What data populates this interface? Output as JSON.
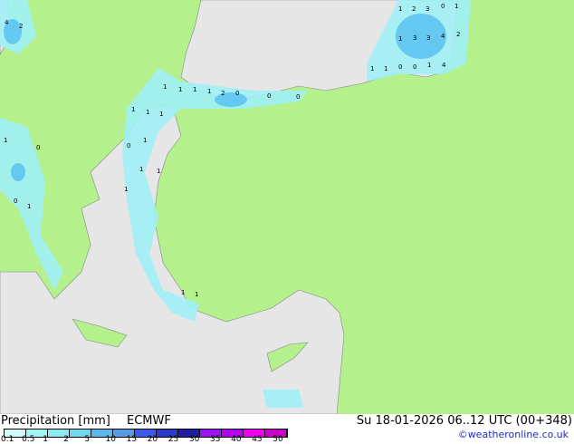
{
  "title": "Precipitation [mm]",
  "model": "ECMWF",
  "valid": "Su 18-01-2026 06..12 UTC (00+348)",
  "credit": "©weatheronline.co.uk",
  "legend": {
    "labels": [
      "0.1",
      "0.5",
      "1",
      "2",
      "5",
      "10",
      "15",
      "20",
      "25",
      "30",
      "35",
      "40",
      "45",
      "50"
    ],
    "colors": [
      "#d2fafa",
      "#a0f5f5",
      "#8ceaf0",
      "#6ed8ee",
      "#5ab9e8",
      "#5a9be6",
      "#3c5af0",
      "#2d3cc8",
      "#1e1ea0",
      "#9b14f0",
      "#b400f0",
      "#f000f0",
      "#c800c8"
    ]
  },
  "colors": {
    "land": "#b4f08c",
    "sea": "#e6e6e6",
    "precip_light": "#a0f0f5",
    "precip_mid": "#64c8f0"
  },
  "map_labels": [
    "1",
    "2",
    "3",
    "0",
    "1",
    "1",
    "3",
    "3",
    "4",
    "2",
    "1",
    "1",
    "0",
    "0",
    "1",
    "4",
    "1",
    "1",
    "1",
    "1",
    "2",
    "0",
    "0",
    "0",
    "1",
    "1",
    "1",
    "1",
    "0",
    "1",
    "1",
    "1",
    "0",
    "1",
    "4",
    "2",
    "0",
    "1",
    "1",
    "1"
  ]
}
